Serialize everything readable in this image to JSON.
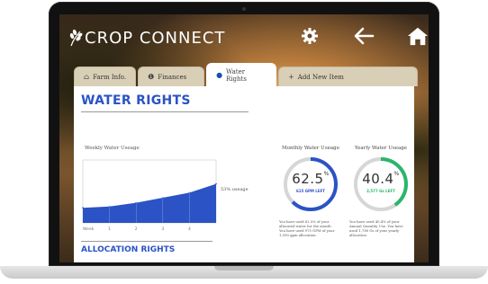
{
  "app": {
    "title": "CROP CONNECT"
  },
  "topbar": {
    "icons": [
      "gear-icon",
      "back-arrow-icon",
      "home-icon"
    ]
  },
  "tabs": [
    {
      "label": "Farm Info.",
      "icon": "barn-icon"
    },
    {
      "label": "Finances",
      "icon": "dollar-icon"
    },
    {
      "label": "Water Rights",
      "icon": "water-drop-icon",
      "active": true
    },
    {
      "label": "Add New Item",
      "icon": "plus-icon"
    }
  ],
  "page": {
    "title": "WATER RIGHTS",
    "weekly_label": "Weekly Water Useage",
    "usage_pct": "53% useage",
    "x_first_label": "Week",
    "x_ticks": [
      "1",
      "2",
      "3",
      "4"
    ],
    "allocation_title": "ALLOCATION RIGHTS"
  },
  "chart_data": {
    "type": "area",
    "title": "Weekly Water Useage",
    "x": [
      0,
      1,
      2,
      3,
      4,
      5
    ],
    "values": [
      24,
      26,
      32,
      40,
      48,
      62
    ],
    "xlabel": "Week",
    "ylim": [
      0,
      100
    ]
  },
  "monthly": {
    "title": "Monthly Water Useage",
    "value": "62.5",
    "unit": "%",
    "sub": "615 GPM LEFT",
    "fraction": 0.625,
    "color": "#2b53c6",
    "note": "You have used 62.5% of your allocated water for the month. You have used 975 GPM of your 1,590 gpm allocation."
  },
  "yearly": {
    "title": "Yearly Water Useage",
    "value": "40.4",
    "unit": "%",
    "sub": "2,577 Gs LEFT",
    "fraction": 0.404,
    "color": "#2bb56a",
    "note": "You have used 40.4% of your Annual Quantity Use. You have used 1,780 Gs of your yearly allocation."
  }
}
